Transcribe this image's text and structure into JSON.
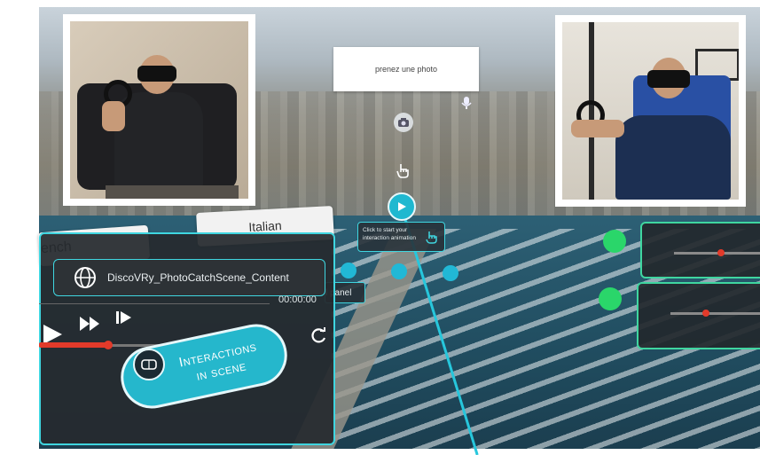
{
  "photo_hud": {
    "label": "prenez une photo"
  },
  "languages": {
    "left": "ench",
    "right": "Italian"
  },
  "media_panel": {
    "title": "DiscoVRy_PhotoCatchScene_Content",
    "time": "00:00:00",
    "side_label": "l panel",
    "progress": 0.35,
    "interactions_line1": "Interactions",
    "interactions_line2": "in scene"
  },
  "tooltip": {
    "text": "Click to start your interaction animation"
  },
  "sliders": [
    {
      "value": 0.55
    },
    {
      "value": 0.4
    }
  ],
  "colors": {
    "accent": "#3fd6e0",
    "green": "#2ad66a",
    "red": "#e23a2a"
  },
  "icons": [
    "globe-icon",
    "play-icon",
    "fast-forward-icon",
    "skip-icon",
    "loop-icon",
    "camera-icon",
    "microphone-icon",
    "hand-cursor-icon",
    "vr-headset-icon"
  ]
}
